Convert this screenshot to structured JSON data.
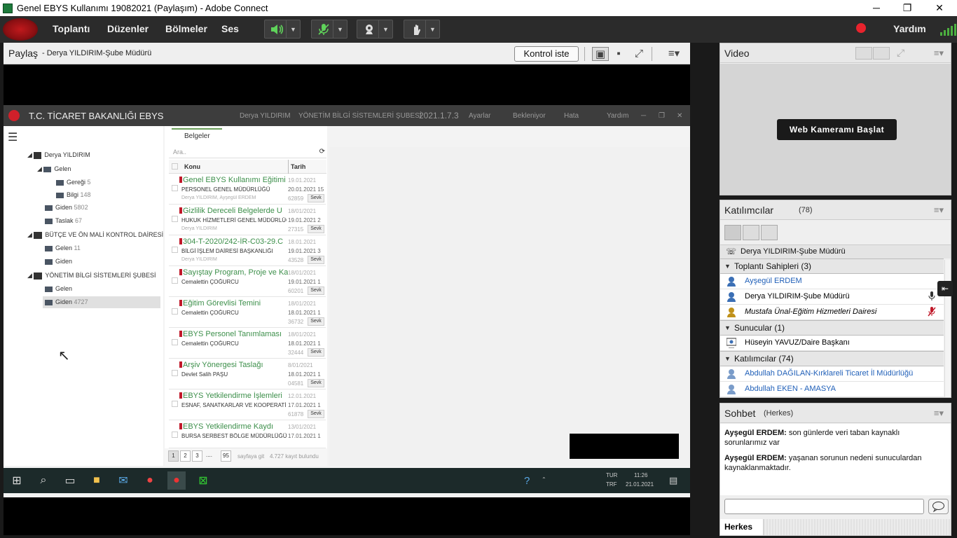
{
  "window": {
    "title": "Genel EBYS Kullanımı  19082021 (Paylaşım) - Adobe Connect"
  },
  "menu": {
    "items": [
      "Toplantı",
      "Düzenler",
      "Bölmeler",
      "Ses"
    ],
    "help": "Yardım"
  },
  "share_pod": {
    "title": "Paylaş",
    "presenter": "- Derya YILDIRIM-Şube Müdürü",
    "request_control": "Kontrol iste"
  },
  "ebys": {
    "title": "T.C. TİCARET BAKANLIĞI EBYS",
    "user": "Derya YILDIRIM",
    "unit": "YÖNETİM BİLGİ SİSTEMLERİ ŞUBESİ",
    "version": "2021.1.7.3",
    "menu_right": [
      "Ayarlar",
      "Bekleniyor",
      "Hata",
      "Yardım"
    ],
    "tree": [
      {
        "label": "Derya YILDIRIM",
        "count": ""
      },
      {
        "label": "Gelen",
        "count": ""
      },
      {
        "label": "Gereği",
        "count": "5"
      },
      {
        "label": "Bilgi",
        "count": "148"
      },
      {
        "label": "Giden",
        "count": "5802"
      },
      {
        "label": "Taslak",
        "count": "67"
      },
      {
        "label": "BÜTÇE VE ÖN MALİ KONTROL DAİRESİ",
        "count": ""
      },
      {
        "label": "Gelen",
        "count": "11"
      },
      {
        "label": "Giden",
        "count": ""
      },
      {
        "label": "YÖNETİM BİLGİ SİSTEMLERİ ŞUBESİ",
        "count": ""
      },
      {
        "label": "Gelen",
        "count": ""
      },
      {
        "label": "Giden",
        "count": "4727"
      }
    ],
    "tab": "Belgeler",
    "search_placeholder": "Ara..",
    "col_subject": "Konu",
    "col_date": "Tarih",
    "sevk": "Sevk",
    "docs": [
      {
        "subject": "Genel EBYS Kullanımı Eğitimi",
        "org": "PERSONEL GENEL MÜDÜRLÜĞÜ",
        "user": "Derya YILDIRIM, Ayşegül ERDEM",
        "d1": "19.01.2021",
        "d2": "20.01.2021 15",
        "d3": "62859"
      },
      {
        "subject": "Gizlilik Dereceli Belgelerde U",
        "org": "HUKUK HİZMETLERİ GENEL MÜDÜRLÜĞ",
        "user": "Derya YILDIRIM",
        "d1": "18/01/2021",
        "d2": "19.01.2021 2",
        "d3": "27315"
      },
      {
        "subject": "304-T-2020/242-İR-C03-29.C",
        "org": "BİLGİ İŞLEM DAİRESİ BAŞKANLIĞI",
        "user": "Derya YILDIRIM",
        "d1": "18.01.2021",
        "d2": "19.01.2021 3",
        "d3": "43528"
      },
      {
        "subject": "Sayıştay Program, Proje ve Ka",
        "org": "Cemalettin ÇOĞURCU",
        "user": "",
        "d1": "18/01/2021",
        "d2": "19.01.2021 1",
        "d3": "60201"
      },
      {
        "subject": "Eğitim Görevlisi Temini",
        "org": "Cemalettin ÇOĞURCU",
        "user": "",
        "d1": "18/01/2021",
        "d2": "18.01.2021 1",
        "d3": "36732"
      },
      {
        "subject": "EBYS Personel Tanımlaması",
        "org": "Cemalettin ÇOĞURCU",
        "user": "",
        "d1": "18/01/2021",
        "d2": "18.01.2021 1",
        "d3": "32444"
      },
      {
        "subject": "Arşiv Yönergesi Taslağı",
        "org": "Devlet Salih PAŞU",
        "user": "",
        "d1": "8/01/2021",
        "d2": "18.01.2021 1",
        "d3": "04581"
      },
      {
        "subject": "EBYS Yetkilendirme İşlemleri",
        "org": "ESNAF, SANATKARLAR VE KOOPERATİF",
        "user": "",
        "d1": "12.01.2021",
        "d2": "17.01.2021 1",
        "d3": "61878"
      },
      {
        "subject": "EBYS Yetkilendirme Kaydı",
        "org": "BURSA SERBEST BÖLGE MÜDÜRLÜĞÜ",
        "user": "",
        "d1": "13/01/2021",
        "d2": "17.01.2021 1",
        "d3": ""
      }
    ],
    "pager": {
      "pages": [
        "1",
        "2",
        "3",
        "....",
        "95"
      ],
      "goto": "sayfaya git",
      "summary": "4.727 kayıt bulundu"
    }
  },
  "taskbar": {
    "lang1": "TUR",
    "lang2": "TRF",
    "time": "11:26",
    "date": "21.01.2021"
  },
  "video_pod": {
    "title": "Video",
    "start_webcam": "Web Kameramı Başlat"
  },
  "participants_pod": {
    "title": "Katılımcılar",
    "count": "(78)",
    "active_presenter": "Derya YILDIRIM-Şube Müdürü",
    "groups": [
      {
        "label": "Toplantı Sahipleri (3)"
      },
      {
        "label": "Sunucular (1)"
      },
      {
        "label": "Katılımcılar (74)"
      }
    ],
    "hosts": [
      "Ayşegül ERDEM",
      "Derya YILDIRIM-Şube Müdürü",
      "Mustafa Ünal-Eğitim Hizmetleri Dairesi"
    ],
    "presenters": [
      "Hüseyin YAVUZ/Daire Başkanı"
    ],
    "attendees": [
      "Abdullah DAĞILAN-Kırklareli Ticaret İl Müdürlüğü",
      "Abdullah EKEN - AMASYA"
    ]
  },
  "chat_pod": {
    "title": "Sohbet",
    "scope": "(Herkes)",
    "messages": [
      {
        "author": "Ayşegül ERDEM:",
        "text": " son günlerde veri taban kaynaklı sorunlarımız var"
      },
      {
        "author": "Ayşegül ERDEM:",
        "text": " yaşanan sorunun nedeni sunuculardan kaynaklanmaktadır."
      }
    ],
    "tab": "Herkes"
  },
  "colors": {
    "accent_green": "#3c8f4a",
    "record_red": "#e8232d",
    "link_blue": "#1f5fb8"
  }
}
